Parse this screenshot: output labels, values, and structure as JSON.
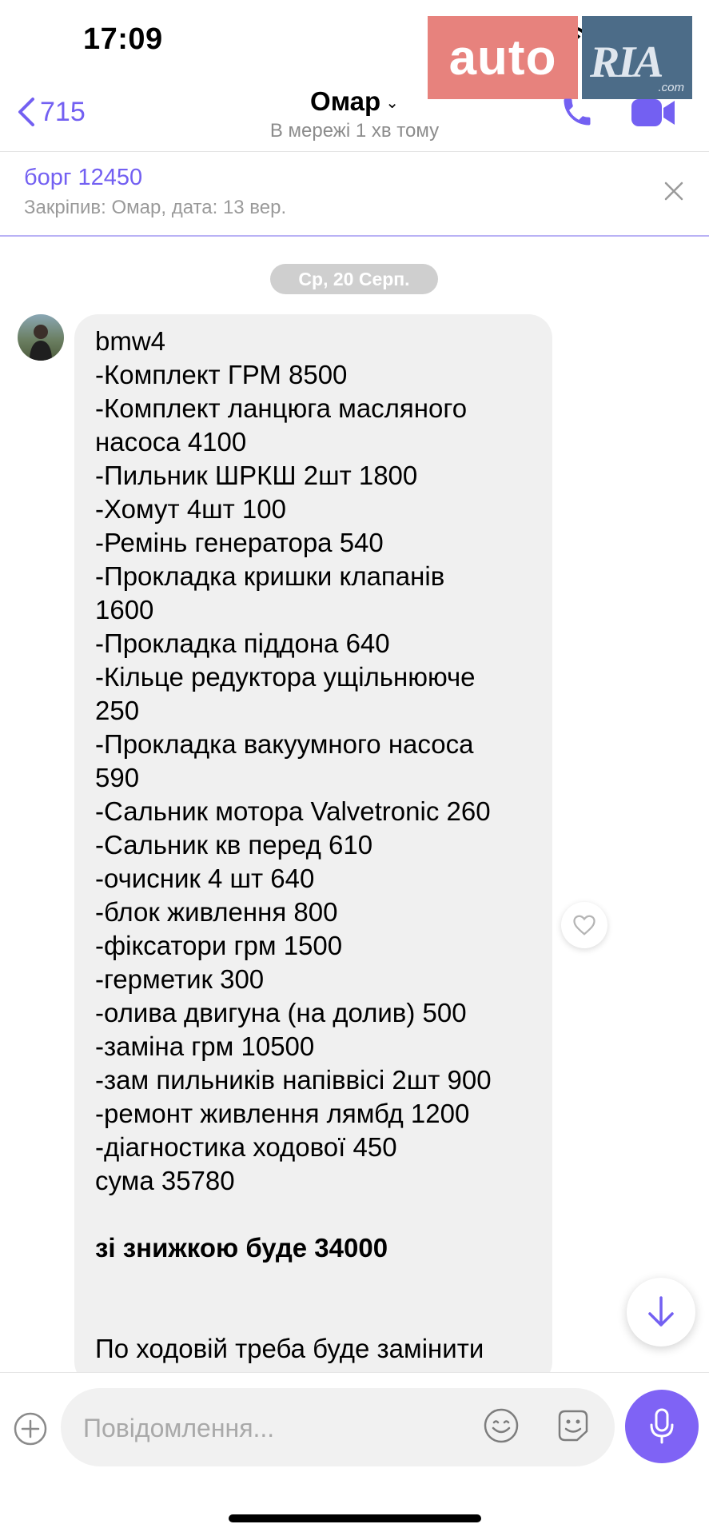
{
  "status_bar": {
    "time": "17:09"
  },
  "watermark": {
    "left": "auto",
    "right": "RIA",
    "suffix": ".com"
  },
  "header": {
    "back_count": "715",
    "contact_name": "Омар",
    "status": "В мережі 1 хв тому"
  },
  "pinned": {
    "title": "борг 12450",
    "subtitle": "Закріпив: Омар, дата: 13 вер."
  },
  "chat": {
    "date": "Ср, 20 Серп.",
    "message_lines": [
      "bmw4",
      "-Комплект ГРМ 8500",
      "-Комплект ланцюга масляного",
      "насоса 4100",
      "-Пильник ШРКШ 2шт 1800",
      "-Хомут 4шт 100",
      "-Ремінь генератора 540",
      "-Прокладка кришки клапанів",
      "1600",
      "-Прокладка піддона 640",
      "-Кільце редуктора ущільнююче",
      "250",
      "-Прокладка вакуумного насоса",
      "590",
      "-Сальник мотора Valvetronic 260",
      "-Сальник кв перед 610",
      "-очисник 4 шт 640",
      "-блок живлення 800",
      "-фіксатори грм 1500",
      "-герметик 300",
      "-олива двигуна (на долив) 500",
      "-заміна грм 10500",
      "-зам пильників напіввісі 2шт 900",
      "-ремонт живлення лямбд 1200",
      "-діагностика ходової 450",
      "сума 35780"
    ],
    "discount_line": "зі знижкою буде 34000",
    "tail_line": "По ходовій треба буде замінити"
  },
  "composer": {
    "placeholder": "Повідомлення..."
  },
  "colors": {
    "accent": "#7360f2",
    "bubble": "#f0f0f0",
    "date_pill": "#cfcfcf"
  }
}
